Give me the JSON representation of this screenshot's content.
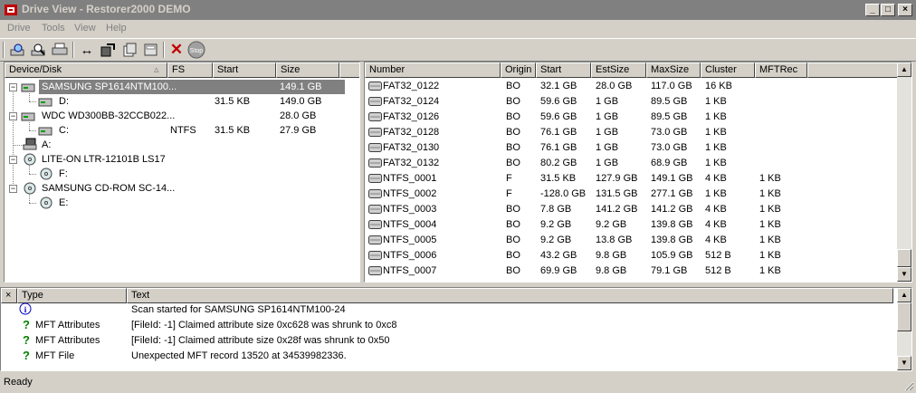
{
  "window": {
    "title": "Drive View - Restorer2000 DEMO"
  },
  "menu": [
    "Drive",
    "Tools",
    "View",
    "Help"
  ],
  "toolbar": [
    {
      "icon": "scan-icon"
    },
    {
      "icon": "find-icon"
    },
    {
      "icon": "print-icon"
    },
    {
      "icon": "resize-icon"
    },
    {
      "icon": "export-icon"
    },
    {
      "icon": "copy-icon"
    },
    {
      "icon": "open-image-icon"
    },
    {
      "icon": "delete-icon"
    },
    {
      "icon": "stop-icon",
      "label": "Stop"
    }
  ],
  "left_table": {
    "headers": [
      "Device/Disk",
      "FS",
      "Start",
      "Size"
    ],
    "rows": [
      {
        "name": "SAMSUNG SP1614NTM100...",
        "fs": "",
        "start": "",
        "size": "149.1 GB",
        "level": 0,
        "selected": true
      },
      {
        "name": "D:",
        "fs": "",
        "start": "31.5 KB",
        "size": "149.0 GB",
        "level": 1
      },
      {
        "name": "WDC WD300BB-32CCB022...",
        "fs": "",
        "start": "",
        "size": "28.0 GB",
        "level": 0
      },
      {
        "name": "C:",
        "fs": "NTFS",
        "start": "31.5 KB",
        "size": "27.9 GB",
        "level": 1
      },
      {
        "name": "A:",
        "fs": "",
        "start": "",
        "size": "",
        "level": 0
      },
      {
        "name": "LITE-ON LTR-12101B LS17",
        "fs": "",
        "start": "",
        "size": "",
        "level": 0
      },
      {
        "name": "F:",
        "fs": "",
        "start": "",
        "size": "",
        "level": 1
      },
      {
        "name": "SAMSUNG CD-ROM SC-14...",
        "fs": "",
        "start": "",
        "size": "",
        "level": 0
      },
      {
        "name": "E:",
        "fs": "",
        "start": "",
        "size": "",
        "level": 1
      }
    ]
  },
  "right_table": {
    "headers": [
      "Number",
      "Origin",
      "Start",
      "EstSize",
      "MaxSize",
      "Cluster",
      "MFTRec"
    ],
    "rows": [
      [
        "FAT32_0122",
        "BO",
        "32.1 GB",
        "28.0 GB",
        "117.0 GB",
        "16 KB",
        ""
      ],
      [
        "FAT32_0124",
        "BO",
        "59.6 GB",
        "1 GB",
        "89.5 GB",
        "1 KB",
        ""
      ],
      [
        "FAT32_0126",
        "BO",
        "59.6 GB",
        "1 GB",
        "89.5 GB",
        "1 KB",
        ""
      ],
      [
        "FAT32_0128",
        "BO",
        "76.1 GB",
        "1 GB",
        "73.0 GB",
        "1 KB",
        ""
      ],
      [
        "FAT32_0130",
        "BO",
        "76.1 GB",
        "1 GB",
        "73.0 GB",
        "1 KB",
        ""
      ],
      [
        "FAT32_0132",
        "BO",
        "80.2 GB",
        "1 GB",
        "68.9 GB",
        "1 KB",
        ""
      ],
      [
        "NTFS_0001",
        "F",
        "31.5 KB",
        "127.9 GB",
        "149.1 GB",
        "4 KB",
        "1 KB"
      ],
      [
        "NTFS_0002",
        "F",
        "-128.0 GB",
        "131.5 GB",
        "277.1 GB",
        "1 KB",
        "1 KB"
      ],
      [
        "NTFS_0003",
        "BO",
        "7.8 GB",
        "141.2 GB",
        "141.2 GB",
        "4 KB",
        "1 KB"
      ],
      [
        "NTFS_0004",
        "BO",
        "9.2 GB",
        "9.2 GB",
        "139.8 GB",
        "4 KB",
        "1 KB"
      ],
      [
        "NTFS_0005",
        "BO",
        "9.2 GB",
        "13.8 GB",
        "139.8 GB",
        "4 KB",
        "1 KB"
      ],
      [
        "NTFS_0006",
        "BO",
        "43.2 GB",
        "9.8 GB",
        "105.9 GB",
        "512 B",
        "1 KB"
      ],
      [
        "NTFS_0007",
        "BO",
        "69.9 GB",
        "9.8 GB",
        "79.1 GB",
        "512 B",
        "1 KB"
      ]
    ]
  },
  "log": {
    "headers": [
      "Type",
      "Text"
    ],
    "rows": [
      {
        "icon": "info-icon",
        "type": "",
        "text": "Scan started for SAMSUNG SP1614NTM100-24"
      },
      {
        "icon": "question-icon",
        "type": "MFT Attributes",
        "text": "[FileId: -1] Claimed attribute size 0xc628 was shrunk to 0xc8"
      },
      {
        "icon": "question-icon",
        "type": "MFT Attributes",
        "text": "[FileId: -1] Claimed attribute size 0x28f was shrunk to 0x50"
      },
      {
        "icon": "question-icon",
        "type": "MFT File",
        "text": "Unexpected MFT record 13520 at 34539982336."
      }
    ]
  },
  "status": {
    "text": "Ready"
  },
  "colors": {
    "selection": "#808080",
    "question": "#008000",
    "info": "#0000ff"
  }
}
